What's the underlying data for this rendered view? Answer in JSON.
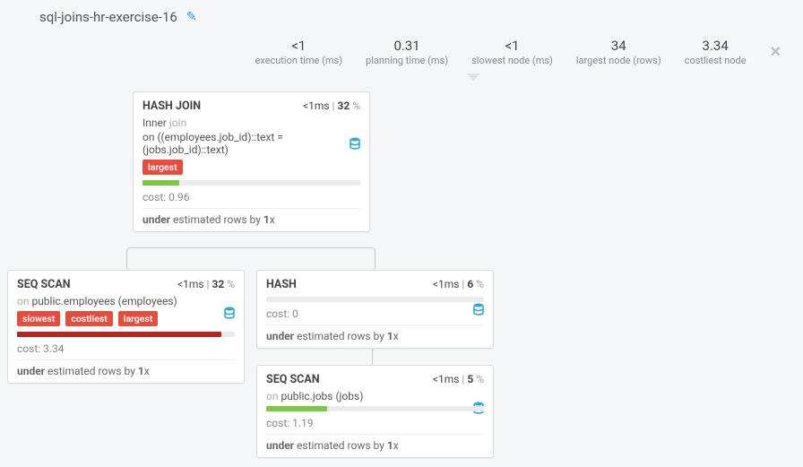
{
  "title": "sql-joins-hr-exercise-16",
  "stats": {
    "exec_value": "<1",
    "exec_label": "execution time (ms)",
    "plan_value": "0.31",
    "plan_label": "planning time (ms)",
    "slow_value": "<1",
    "slow_label": "slowest node (ms)",
    "largest_value": "34",
    "largest_label": "largest node (rows)",
    "costliest_value": "3.34",
    "costliest_label": "costliest node"
  },
  "nodes": {
    "hashjoin": {
      "title": "HASH JOIN",
      "time": "<1ms",
      "pct": "32",
      "sub_prefix": "Inner",
      "sub_suffix": " join",
      "cond": "on ((employees.job_id)::text = (jobs.job_id)::text)",
      "badge1": "largest",
      "cost_label": "cost: ",
      "cost": "0.96",
      "est_prefix": "under",
      "est_mid": " estimated rows by ",
      "est_x": "1",
      "est_suf": "x"
    },
    "seqscan1": {
      "title": "SEQ SCAN",
      "time": "<1ms",
      "pct": "32",
      "on_prefix": "on ",
      "on_target": "public.employees (employees)",
      "badge1": "slowest",
      "badge2": "costliest",
      "badge3": "largest",
      "cost_label": "cost: ",
      "cost": "3.34",
      "est_prefix": "under",
      "est_mid": " estimated rows by ",
      "est_x": "1",
      "est_suf": "x"
    },
    "hash": {
      "title": "HASH",
      "time": "<1ms",
      "pct": "6",
      "cost_label": "cost: ",
      "cost": "0",
      "est_prefix": "under",
      "est_mid": " estimated rows by ",
      "est_x": "1",
      "est_suf": "x"
    },
    "seqscan2": {
      "title": "SEQ SCAN",
      "time": "<1ms",
      "pct": "5",
      "on_prefix": "on ",
      "on_target": "public.jobs (jobs)",
      "cost_label": "cost: ",
      "cost": "1.19",
      "est_prefix": "under",
      "est_mid": " estimated rows by ",
      "est_x": "1",
      "est_suf": "x"
    }
  }
}
